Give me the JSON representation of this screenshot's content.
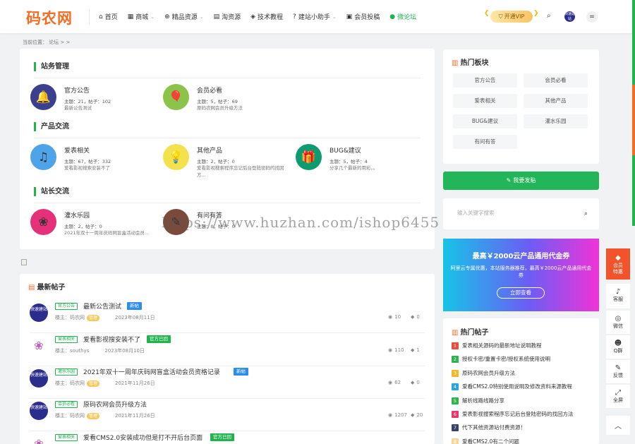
{
  "header": {
    "logo": "码农网",
    "nav": [
      {
        "icon": "home-icon",
        "glyph": "⌂",
        "label": "首页",
        "dropdown": false
      },
      {
        "icon": "shop-icon",
        "glyph": "▦",
        "label": "商城",
        "dropdown": true
      },
      {
        "icon": "globe-icon",
        "glyph": "⊕",
        "label": "精品资源",
        "dropdown": true
      },
      {
        "icon": "box-icon",
        "glyph": "▤",
        "label": "淘资源",
        "dropdown": false
      },
      {
        "icon": "mortarboard-icon",
        "glyph": "◈",
        "label": "技术教程",
        "dropdown": false
      },
      {
        "icon": "question-icon",
        "glyph": "?",
        "label": "建站小助手",
        "dropdown": true
      },
      {
        "icon": "book-icon",
        "glyph": "▣",
        "label": "会员投稿",
        "dropdown": false
      },
      {
        "icon": "chat-icon",
        "glyph": "●",
        "label": "微论坛",
        "dropdown": false
      }
    ],
    "vip_label": "开通VIP",
    "avatar_text": "快速建站",
    "menu_glyph": "="
  },
  "breadcrumb": "当前位置： 论坛 > >",
  "sections": [
    {
      "title": "站务管理",
      "forums": [
        {
          "name": "官方公告",
          "stats": "主题：21，帖子：102",
          "desc": "最新公告测试",
          "icon": "bell-icon",
          "glyph": "🔔",
          "bg": "#3b3f8f"
        },
        {
          "name": "会员必看",
          "stats": "主题：5，帖子：69",
          "desc": "原码农网会员升级方法",
          "icon": "balloon-icon",
          "glyph": "🎈",
          "bg": "#8cc34b"
        }
      ]
    },
    {
      "title": "产品交流",
      "forums": [
        {
          "name": "爱表相关",
          "stats": "主题：67，帖子：332",
          "desc": "爱看影视搜索安装不了",
          "icon": "music-icon",
          "glyph": "♫",
          "bg": "#4ea4e8"
        },
        {
          "name": "其他产品",
          "stats": "主题：2，帖子：0",
          "desc": "爱看影视搜索程序忘记后台登陆密码的找回方...",
          "icon": "bulb-icon",
          "glyph": "💡",
          "bg": "#f3e24d"
        },
        {
          "name": "BUG&建议",
          "stats": "主题：5，帖子：4",
          "desc": "分享几个最新的用彩。。",
          "icon": "gift-icon",
          "glyph": "🎁",
          "bg": "#0d9c71"
        }
      ]
    },
    {
      "title": "站长交流",
      "forums": [
        {
          "name": "灌水乐园",
          "stats": "主题：2，帖子：0",
          "desc": "2021年双十一周年庆码网盲盒活动会员...",
          "icon": "flower-icon",
          "glyph": "❀",
          "bg": "#e4317a"
        },
        {
          "name": "有问有答",
          "stats": "主题：0，帖子：0",
          "desc": "",
          "icon": "pencil-icon",
          "glyph": "✎",
          "bg": "#7a4a3a"
        }
      ]
    }
  ],
  "latest": {
    "title": "最新帖子",
    "posts": [
      {
        "tag": "官方公告",
        "title": "最新公告测试",
        "badge": "新帖",
        "badge_color": "#2d8cf0",
        "author": "楼主：码农网",
        "level": "管理",
        "date": "2023年08月11日",
        "views": "10",
        "comments": "0",
        "avatar": "快速建站",
        "lotus": false
      },
      {
        "tag": "爱表相关",
        "title": "爱看影视搜安装不了",
        "badge": "官方已回",
        "badge_color": "#1fb44e",
        "author": "楼主：southys",
        "level": "",
        "date": "2023年08月10日",
        "views": "110",
        "comments": "1",
        "avatar": "",
        "lotus": true
      },
      {
        "tag": "灌水乐园",
        "title": "2021年双十一周年庆码网盲盒活动会员资格记录",
        "badge": "新帖",
        "badge_color": "#2d8cf0",
        "author": "楼主：码农网",
        "level": "管理",
        "date": "2021年11月26日",
        "views": "62",
        "comments": "0",
        "avatar": "快速建站",
        "lotus": false
      },
      {
        "tag": "会员必看",
        "title": "原码农网会员升级方法",
        "badge": "",
        "badge_color": "",
        "author": "楼主：码农网",
        "level": "管理",
        "date": "2021年11月26日",
        "views": "1207",
        "comments": "20",
        "avatar": "快速建站",
        "lotus": false
      },
      {
        "tag": "爱表相关",
        "title": "爱看CMS2.0安装成功但是打不开后台页面",
        "badge": "官方已回",
        "badge_color": "#1fb44e",
        "author": "",
        "level": "",
        "date": "",
        "views": "",
        "comments": "",
        "avatar": "",
        "lotus": true
      }
    ]
  },
  "hot_boards": {
    "title": "热门板块",
    "items": [
      "官方公告",
      "会员必看",
      "爱表相关",
      "其他产品",
      "BUG&建议",
      "灌水乐园",
      "有问有答"
    ]
  },
  "post_button": "我要发贴",
  "search_placeholder": "输入关键字搜索",
  "promo": {
    "title": "最高￥2000云产品通用代金券",
    "subtitle": "阿里云专属优惠，本站服务器推荐，最高￥2000云产品通用代金券",
    "button": "立即查看"
  },
  "hot_posts": {
    "title": "热门帖子",
    "items": [
      {
        "n": "1",
        "color": "#e84c3d",
        "text": "爱表相关源码的最新地址说明教程"
      },
      {
        "n": "2",
        "color": "#2fb34a",
        "text": "授权卡密/重置卡密/授权系统使用说明"
      },
      {
        "n": "3",
        "color": "#f1b72b",
        "text": "原码农网会员升级方法"
      },
      {
        "n": "4",
        "color": "#26a5e0",
        "text": "爱看CMS2.0特别使用说明及修改资料来源教程"
      },
      {
        "n": "5",
        "color": "#2fb34a",
        "text": "解析线路线路分享"
      },
      {
        "n": "6",
        "color": "#e8386b",
        "text": "爱表影视搜索程序忘记后台登陆密码的找回方法"
      },
      {
        "n": "7",
        "color": "#334466",
        "text": "代下其他资源站付费资源！"
      },
      {
        "n": "8",
        "color": "#f3d89a",
        "text": "爱看CMS2.0有二个问题"
      }
    ]
  },
  "sidebar_float": [
    {
      "icon": "diamond-icon",
      "glyph": "◆",
      "label": "会员\n特惠"
    },
    {
      "icon": "bell-icon",
      "glyph": "♪",
      "label": "客服"
    },
    {
      "icon": "wechat-icon",
      "glyph": "◎",
      "label": "微信"
    },
    {
      "icon": "users-icon",
      "glyph": "☻",
      "label": "Q群"
    },
    {
      "icon": "edit-icon",
      "glyph": "✎",
      "label": "反馈"
    },
    {
      "icon": "fullscreen-icon",
      "glyph": "⤢",
      "label": "全屏"
    },
    {
      "icon": "chevron-up-icon",
      "glyph": "︿",
      "label": ""
    }
  ],
  "watermark": "https://www.huzhan.com/ishop6455",
  "colors": {
    "brand": "#f36c21",
    "accent": "#1fb44e",
    "promo_start": "#16c4e6",
    "promo_end": "#f133d8"
  }
}
